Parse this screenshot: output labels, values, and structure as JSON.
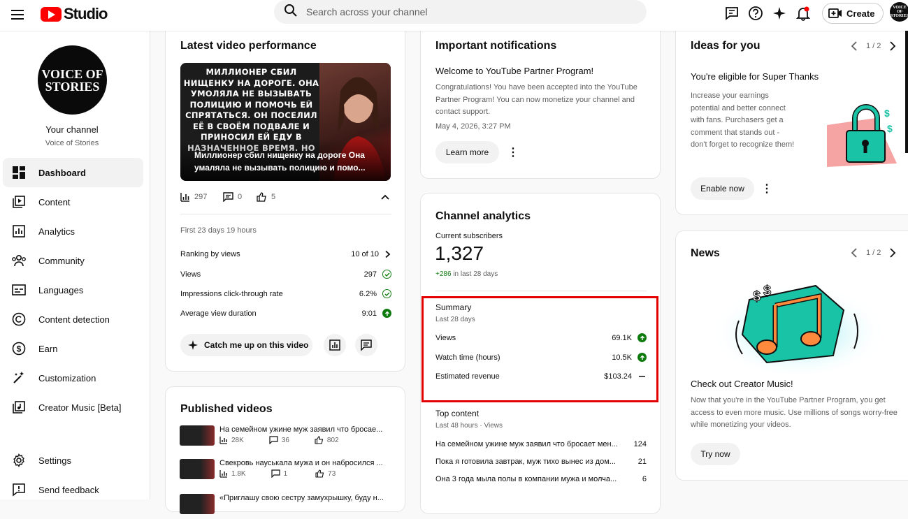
{
  "header": {
    "logo_text": "Studio",
    "search_placeholder": "Search across your channel",
    "create_label": "Create",
    "avatar_text": "VOICE OF STORIES"
  },
  "sidebar": {
    "channel_avatar_text": "VOICE OF STORIES",
    "your_channel": "Your channel",
    "channel_name": "Voice of Stories",
    "items": [
      {
        "label": "Dashboard",
        "icon": "dashboard-icon",
        "active": true
      },
      {
        "label": "Content",
        "icon": "content-icon"
      },
      {
        "label": "Analytics",
        "icon": "analytics-icon"
      },
      {
        "label": "Community",
        "icon": "community-icon"
      },
      {
        "label": "Languages",
        "icon": "languages-icon"
      },
      {
        "label": "Content detection",
        "icon": "copyright-icon"
      },
      {
        "label": "Earn",
        "icon": "dollar-icon"
      },
      {
        "label": "Customization",
        "icon": "magic-wand-icon"
      },
      {
        "label": "Creator Music [Beta]",
        "icon": "music-icon"
      }
    ],
    "bottom_items": [
      {
        "label": "Settings",
        "icon": "gear-icon"
      },
      {
        "label": "Send feedback",
        "icon": "feedback-icon"
      }
    ]
  },
  "latest_video": {
    "title": "Latest video performance",
    "thumbnail_text": "МИЛЛИОНЕР СБИЛ НИЩЕНКУ НА ДОРОГЕ. ОНА УМОЛЯЛА НЕ ВЫЗЫВАТЬ ПОЛИЦИЮ И ПОМОЧЬ ЕЙ СПРЯТАТЬСЯ. ОН ПОСЕЛИЛ ЕЁ В СВОЁМ ПОДВАЛЕ И ПРИНОСИЛ ЕЙ ЕДУ В НАЗНАЧЕННОЕ ВРЕМЯ. НО",
    "video_title": "Миллионер сбил нищенку на дороге Она умаляла не вызывать полицию и помо...",
    "views_count": "297",
    "comments_count": "0",
    "likes_count": "5",
    "period": "First 23 days 19 hours",
    "metrics": [
      {
        "label": "Ranking by views",
        "value": "10 of 10"
      },
      {
        "label": "Views",
        "value": "297"
      },
      {
        "label": "Impressions click-through rate",
        "value": "6.2%"
      },
      {
        "label": "Average view duration",
        "value": "9:01"
      }
    ],
    "catch_me_up": "Catch me up on this video"
  },
  "published": {
    "title": "Published videos",
    "videos": [
      {
        "title": "На семейном ужине муж заявил что бросае...",
        "views": "28K",
        "comments": "36",
        "likes": "802"
      },
      {
        "title": "Свекровь науськала мужа и он набросился ...",
        "views": "1.8K",
        "comments": "1",
        "likes": "73"
      },
      {
        "title": "«Приглашу свою сестру замухрышку, буду н...",
        "views": "",
        "comments": "",
        "likes": ""
      }
    ]
  },
  "notifications": {
    "title": "Important notifications",
    "heading": "Welcome to YouTube Partner Program!",
    "body": "Congratulations! You have been accepted into the YouTube Partner Program! You can now monetize your channel and contact support.",
    "date": "May 4, 2026, 3:27 PM",
    "learn_more": "Learn more"
  },
  "analytics": {
    "title": "Channel analytics",
    "subs_label": "Current subscribers",
    "subs_value": "1,327",
    "subs_delta": "+286",
    "subs_delta_suffix": "in last 28 days",
    "summary_title": "Summary",
    "summary_period": "Last 28 days",
    "summary": [
      {
        "label": "Views",
        "value": "69.1K",
        "trend": "up"
      },
      {
        "label": "Watch time (hours)",
        "value": "10.5K",
        "trend": "up"
      },
      {
        "label": "Estimated revenue",
        "value": "$103.24",
        "trend": "flat"
      }
    ],
    "top_title": "Top content",
    "top_period": "Last 48 hours · Views",
    "top": [
      {
        "title": "На семейном ужине муж заявил что бросает мен...",
        "views": "124"
      },
      {
        "title": "Пока я готовила завтрак, муж тихо вынес из дом...",
        "views": "21"
      },
      {
        "title": "Она 3 года мыла полы в компании мужа и молча...",
        "views": "6"
      }
    ]
  },
  "ideas": {
    "title": "Ideas for you",
    "pager": "1 / 2",
    "heading": "You're eligible for Super Thanks",
    "body": "Increase your earnings potential and better connect with fans. Purchasers get a comment that stands out - don't forget to recognize them!",
    "enable": "Enable now"
  },
  "news": {
    "title": "News",
    "pager": "1 / 2",
    "heading": "Check out Creator Music!",
    "body": "Now that you're in the YouTube Partner Program, you get access to even more music. Use millions of songs worry-free while monetizing your videos.",
    "try_now": "Try now"
  },
  "colors": {
    "brand_red": "#ff0000",
    "highlight_red": "#e50000",
    "green": "#0f7b0f",
    "teal": "#19c3a6",
    "orange": "#ff8a3d"
  }
}
